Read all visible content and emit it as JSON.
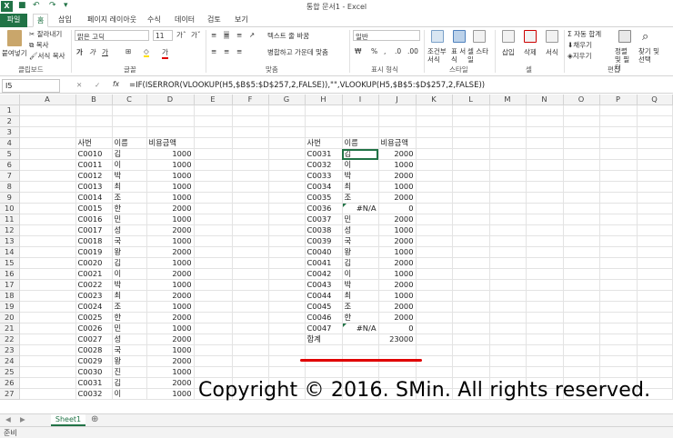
{
  "window": {
    "title": "통합 문서1 - Excel"
  },
  "ribbon_tabs": [
    "파일",
    "홈",
    "삽입",
    "페이지 레이아웃",
    "수식",
    "데이터",
    "검토",
    "보기"
  ],
  "ribbon": {
    "paste": "붙여넣기",
    "cut": "잘라내기",
    "copy": "복사",
    "format_painter": "서식 복사",
    "font_name": "맑은 고딕",
    "font_size": "11",
    "wrap_text": "텍스트 줄 바꿈",
    "merge_center": "병합하고 가운데 맞춤",
    "number_format": "일반",
    "cond_format": "조건부 서식",
    "as_table": "표 서식",
    "cell_styles": "셀 스타일",
    "insert": "삽입",
    "delete": "삭제",
    "format": "서식",
    "autosum": "자동 합계",
    "fill": "채우기",
    "clear": "지우기",
    "sort_filter": "정렬 및 필터",
    "find_select": "찾기 및 선택",
    "groups": [
      "클립보드",
      "글꼴",
      "맞춤",
      "표시 형식",
      "스타일",
      "셀",
      "편집"
    ]
  },
  "formula_bar": {
    "name_box": "I5",
    "fx": "fx",
    "formula": "=IF(ISERROR(VLOOKUP(H5,$B$5:$D$257,2,FALSE)),\"\",VLOOKUP(H5,$B$5:$D$257,2,FALSE))"
  },
  "columns": [
    "A",
    "B",
    "C",
    "D",
    "E",
    "F",
    "G",
    "H",
    "I",
    "J",
    "K",
    "L",
    "M",
    "N",
    "O",
    "P",
    "Q"
  ],
  "row_numbers": [
    "1",
    "2",
    "3",
    "4",
    "5",
    "6",
    "7",
    "8",
    "9",
    "10",
    "11",
    "12",
    "13",
    "14",
    "15",
    "16",
    "17",
    "18",
    "19",
    "20",
    "21",
    "22",
    "23",
    "24",
    "25",
    "26",
    "27"
  ],
  "left_table": {
    "headers": [
      "사번",
      "이름",
      "비용금액"
    ],
    "rows": [
      [
        "C0010",
        "김",
        "1000"
      ],
      [
        "C0011",
        "이",
        "1000"
      ],
      [
        "C0012",
        "박",
        "1000"
      ],
      [
        "C0013",
        "최",
        "1000"
      ],
      [
        "C0014",
        "조",
        "1000"
      ],
      [
        "C0015",
        "한",
        "2000"
      ],
      [
        "C0016",
        "민",
        "1000"
      ],
      [
        "C0017",
        "성",
        "2000"
      ],
      [
        "C0018",
        "국",
        "1000"
      ],
      [
        "C0019",
        "왕",
        "2000"
      ],
      [
        "C0020",
        "김",
        "1000"
      ],
      [
        "C0021",
        "이",
        "2000"
      ],
      [
        "C0022",
        "박",
        "1000"
      ],
      [
        "C0023",
        "최",
        "2000"
      ],
      [
        "C0024",
        "조",
        "1000"
      ],
      [
        "C0025",
        "한",
        "2000"
      ],
      [
        "C0026",
        "민",
        "1000"
      ],
      [
        "C0027",
        "성",
        "2000"
      ],
      [
        "C0028",
        "국",
        "1000"
      ],
      [
        "C0029",
        "왕",
        "2000"
      ],
      [
        "C0030",
        "진",
        "1000"
      ],
      [
        "C0031",
        "김",
        "2000"
      ],
      [
        "C0032",
        "이",
        "1000"
      ]
    ]
  },
  "right_table": {
    "headers": [
      "사번",
      "이름",
      "비용금액"
    ],
    "rows": [
      [
        "C0031",
        "김",
        "2000"
      ],
      [
        "C0032",
        "이",
        "1000"
      ],
      [
        "C0033",
        "박",
        "2000"
      ],
      [
        "C0034",
        "최",
        "1000"
      ],
      [
        "C0035",
        "조",
        "2000"
      ],
      [
        "C0036",
        "#N/A",
        "0"
      ],
      [
        "C0037",
        "민",
        "2000"
      ],
      [
        "C0038",
        "성",
        "1000"
      ],
      [
        "C0039",
        "국",
        "2000"
      ],
      [
        "C0040",
        "왕",
        "1000"
      ],
      [
        "C0041",
        "김",
        "2000"
      ],
      [
        "C0042",
        "이",
        "1000"
      ],
      [
        "C0043",
        "박",
        "2000"
      ],
      [
        "C0044",
        "최",
        "1000"
      ],
      [
        "C0045",
        "조",
        "2000"
      ],
      [
        "C0046",
        "한",
        "2000"
      ],
      [
        "C0047",
        "#N/A",
        "0"
      ]
    ],
    "total_label": "합계",
    "total_value": "23000"
  },
  "watermark": "Copyright © 2016. SMin. All rights reserved.",
  "sheet_tabs": [
    "Sheet1"
  ],
  "status": "준비",
  "colors": {
    "excel_green": "#217346",
    "underline_red": "#e00000"
  }
}
